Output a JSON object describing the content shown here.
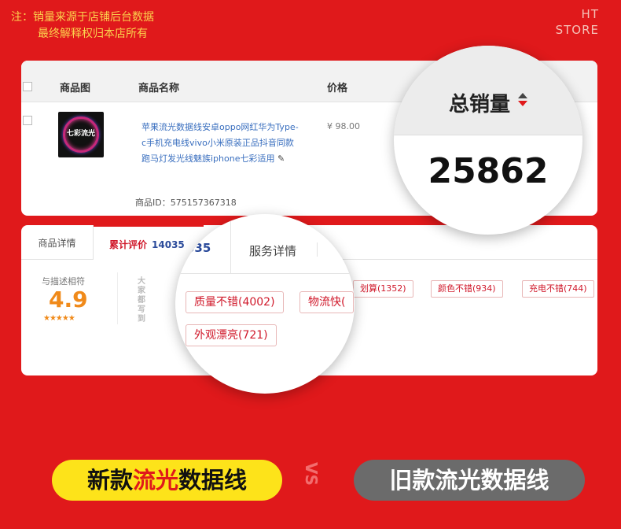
{
  "note": {
    "line1": "注：销量来源于店铺后台数据",
    "line2": "最终解释权归本店所有"
  },
  "brand": {
    "line1": "HT",
    "line2": "STORE"
  },
  "product_table": {
    "col_image": "商品图",
    "col_name": "商品名称",
    "col_price": "价格",
    "thumb_text": "七彩流光",
    "name": "苹果流光数据线安卓oppo网红华为Type-c手机充电线vivo小米原装正品抖音同款跑马灯发光线魅族iphone七彩适用",
    "price": "¥ 98.00",
    "product_id": "商品ID：575157367318"
  },
  "sales_magnifier": {
    "label": "总销量",
    "value": "25862",
    "sort_icon": "sort-icon"
  },
  "review_panel": {
    "tab_detail": "商品详情",
    "tab_reviews": "累计评价",
    "review_count": "14035",
    "score_label": "与描述相符",
    "score": "4.9",
    "stars": "★★★★★",
    "vertical_label": "大家都写到",
    "small_tags": [
      "划算(1352)",
      "颜色不错(934)",
      "充电不错(744)"
    ]
  },
  "review_magnifier": {
    "count_fragment": "035",
    "service_tab": "服务详情",
    "tags": [
      "质量不错(4002)",
      "物流快(",
      "外观漂亮(721)"
    ]
  },
  "comparison": {
    "new_prefix": "新款",
    "new_highlight": "流光",
    "new_suffix": "数据线",
    "vs": "VS",
    "old_label": "旧款流光数据线"
  },
  "colors": {
    "background": "#e0191b",
    "accent_yellow": "#fde31a",
    "old_gray": "#6b6b6b",
    "link_blue": "#3a6fbf"
  }
}
